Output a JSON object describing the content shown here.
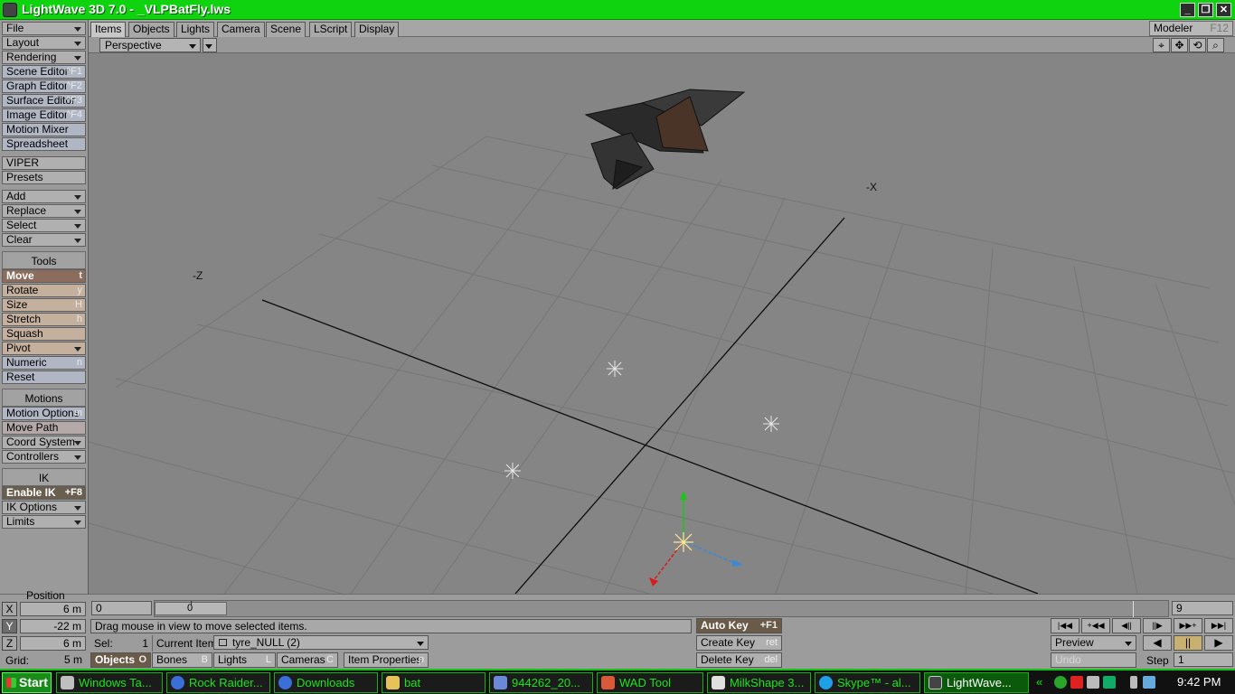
{
  "window": {
    "title": "LightWave 3D 7.0 - _VLPBatFly.lws",
    "controls": [
      "minimize",
      "restore",
      "close"
    ]
  },
  "tabs": [
    "Items",
    "Objects",
    "Lights",
    "Camera",
    "Scene",
    "LScript",
    "Display"
  ],
  "active_tab": "Items",
  "modeler": {
    "label": "Modeler",
    "shortcut": "F12"
  },
  "viewport": {
    "mode": "Perspective",
    "axis_labels": {
      "neg_x": "-X",
      "neg_z": "-Z"
    }
  },
  "sidebar": {
    "top_menus": [
      {
        "label": "File",
        "dropdown": true
      },
      {
        "label": "Layout",
        "dropdown": true
      },
      {
        "label": "Rendering",
        "dropdown": true
      }
    ],
    "editors": [
      {
        "label": "Scene Editor",
        "shortcut": "^F1"
      },
      {
        "label": "Graph Editor",
        "shortcut": "^F2"
      },
      {
        "label": "Surface Editor",
        "shortcut": "^F3"
      },
      {
        "label": "Image Editor",
        "shortcut": "^F4"
      },
      {
        "label": "Motion Mixer",
        "shortcut": ""
      },
      {
        "label": "Spreadsheet",
        "shortcut": ""
      }
    ],
    "viper": "VIPER",
    "presets": "Presets",
    "item_menus": [
      {
        "label": "Add",
        "dropdown": true
      },
      {
        "label": "Replace",
        "dropdown": true
      },
      {
        "label": "Select",
        "dropdown": true
      },
      {
        "label": "Clear",
        "dropdown": true
      }
    ],
    "tools_header": "Tools",
    "tools": [
      {
        "label": "Move",
        "shortcut": "t",
        "selected": true
      },
      {
        "label": "Rotate",
        "shortcut": "y"
      },
      {
        "label": "Size",
        "shortcut": "H"
      },
      {
        "label": "Stretch",
        "shortcut": "h"
      },
      {
        "label": "Squash",
        "shortcut": ""
      },
      {
        "label": "Pivot",
        "dropdown": true
      },
      {
        "label": "Numeric",
        "shortcut": "n"
      },
      {
        "label": "Reset",
        "shortcut": ""
      }
    ],
    "motions_header": "Motions",
    "motions": [
      {
        "label": "Motion Options",
        "shortcut": "m"
      },
      {
        "label": "Move Path",
        "shortcut": ""
      },
      {
        "label": "Coord System",
        "dropdown": true
      },
      {
        "label": "Controllers",
        "dropdown": true
      }
    ],
    "ik_header": "IK",
    "ik": [
      {
        "label": "Enable IK",
        "shortcut": "+F8",
        "active": true
      },
      {
        "label": "IK Options",
        "dropdown": true
      },
      {
        "label": "Limits",
        "dropdown": true
      }
    ]
  },
  "position_panel": {
    "label": "Position",
    "x": {
      "axis": "X",
      "value": "6 m"
    },
    "y": {
      "axis": "Y",
      "value": "-22 m"
    },
    "z": {
      "axis": "Z",
      "value": "6 m"
    },
    "grid": {
      "label": "Grid:",
      "value": "5 m"
    }
  },
  "timeline": {
    "start": "0",
    "current": "0",
    "end": "9"
  },
  "status": "Drag mouse in view to move selected items.",
  "sel": {
    "label": "Sel:",
    "value": "1"
  },
  "current_item": {
    "label": "Current Item",
    "value": "tyre_NULL (2)"
  },
  "item_types": [
    {
      "label": "Objects",
      "shortcut": "O",
      "active": true
    },
    {
      "label": "Bones",
      "shortcut": "B"
    },
    {
      "label": "Lights",
      "shortcut": "L"
    },
    {
      "label": "Cameras",
      "shortcut": "C"
    }
  ],
  "item_properties": {
    "label": "Item Properties",
    "shortcut": "p"
  },
  "keys": {
    "auto_key": {
      "label": "Auto Key",
      "shortcut": "+F1"
    },
    "create_key": {
      "label": "Create Key",
      "shortcut": "ret"
    },
    "delete_key": {
      "label": "Delete Key",
      "shortcut": "del"
    }
  },
  "playback": {
    "buttons": [
      "|◀◀",
      "+◀◀",
      "◀||",
      "||▶",
      "▶▶+",
      "▶▶|"
    ],
    "preview": "Preview",
    "undo": "Undo",
    "step_label": "Step",
    "step_value": "1",
    "back": "◀",
    "pause": "||",
    "play": "▶"
  },
  "taskbar": {
    "start": "Start",
    "tasks": [
      {
        "label": "Windows Ta...",
        "icon": "windows-explorer-icon"
      },
      {
        "label": "Rock Raider...",
        "icon": "browser-icon"
      },
      {
        "label": "Downloads",
        "icon": "browser-icon"
      },
      {
        "label": "bat",
        "icon": "folder-icon"
      },
      {
        "label": "944262_20...",
        "icon": "image-icon"
      },
      {
        "label": "WAD Tool",
        "icon": "app-icon"
      },
      {
        "label": "MilkShape 3...",
        "icon": "milkshape-icon"
      },
      {
        "label": "Skype™ - al...",
        "icon": "skype-icon"
      },
      {
        "label": "LightWave...",
        "icon": "lightwave-icon",
        "active": true
      }
    ],
    "tray_chevron": "«",
    "clock": "9:42 PM"
  },
  "colors": {
    "title_bar": "#0fd30f",
    "taskbar_text": "#19e619",
    "viewport_bg": "#858585",
    "selected_tool": "#8c6c5c"
  }
}
